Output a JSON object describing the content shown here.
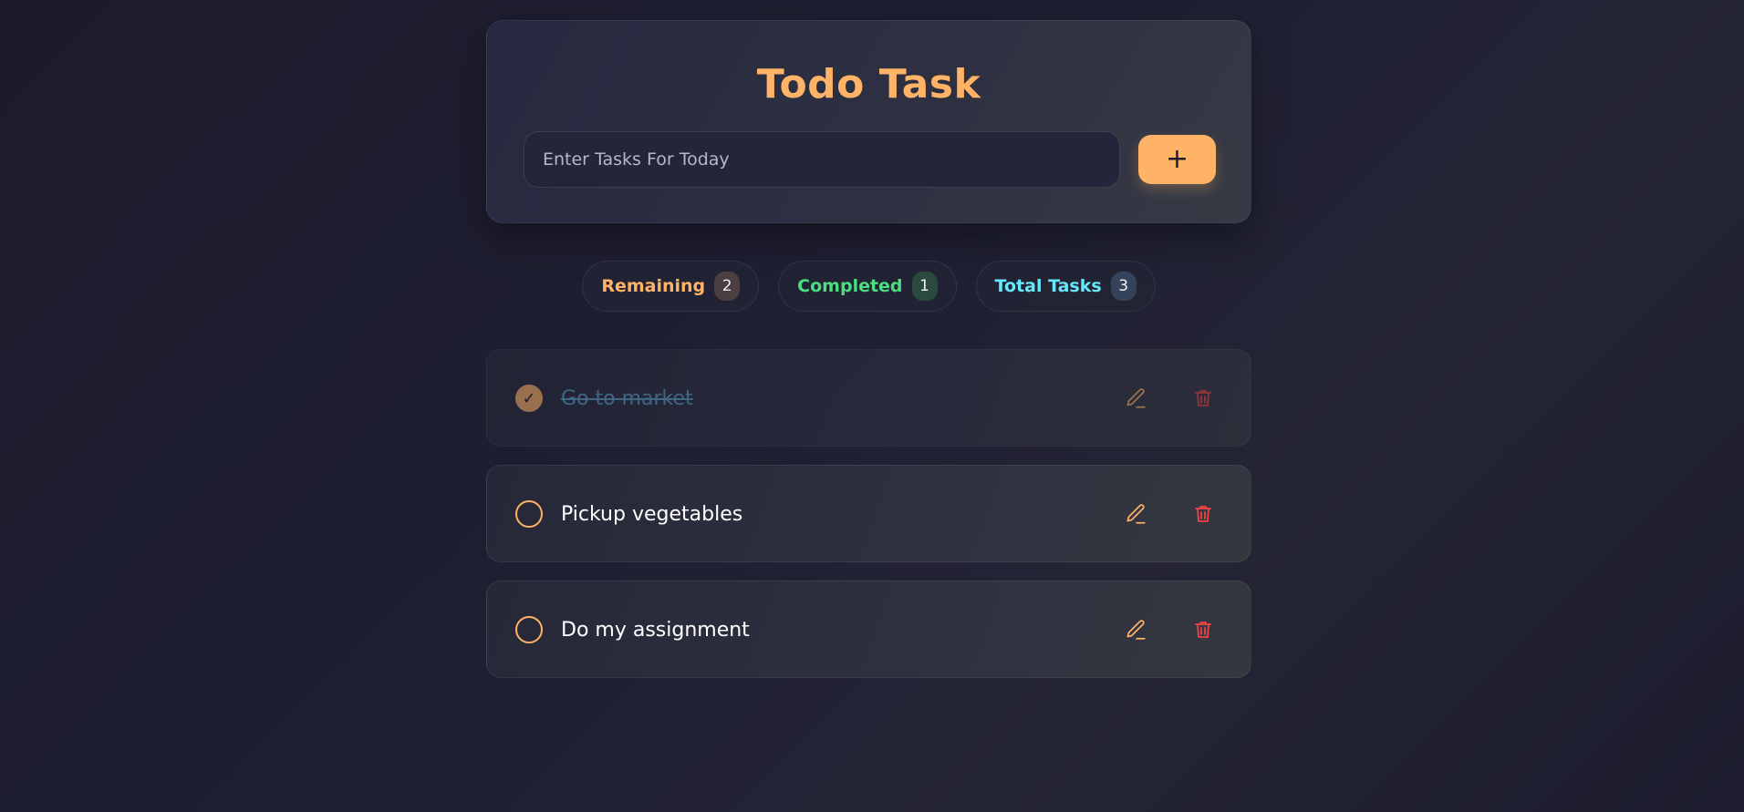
{
  "app": {
    "title": "Todo Task"
  },
  "input": {
    "placeholder": "Enter Tasks For Today",
    "value": "",
    "add_label": "+"
  },
  "stats": {
    "remaining": {
      "label": "Remaining",
      "count": "2"
    },
    "completed": {
      "label": "Completed",
      "count": "1"
    },
    "total": {
      "label": "Total Tasks",
      "count": "3"
    }
  },
  "tasks": [
    {
      "text": "Go to market",
      "completed": true,
      "check_mark": "✓"
    },
    {
      "text": "Pickup vegetables",
      "completed": false,
      "check_mark": ""
    },
    {
      "text": "Do my assignment",
      "completed": false,
      "check_mark": ""
    }
  ],
  "icons": {
    "edit": "pencil-icon",
    "delete": "trash-icon",
    "add": "plus-icon"
  },
  "colors": {
    "accent": "#ffb366",
    "remaining": "#ffb366",
    "completed": "#4ade80",
    "total": "#67e8f9",
    "delete": "#ef4444"
  }
}
